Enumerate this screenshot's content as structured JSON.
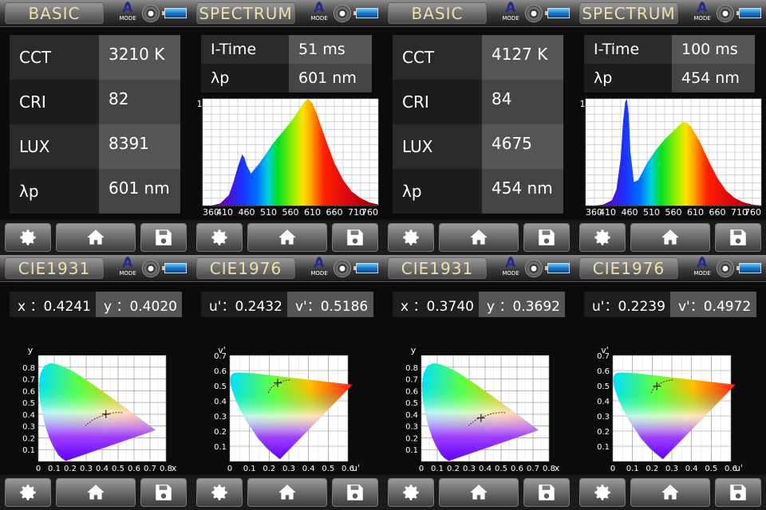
{
  "ui": {
    "mode_letter": "A",
    "mode_text": "MODE"
  },
  "basic1": {
    "title": "BASIC",
    "rows": [
      {
        "label": "CCT",
        "value": "3210 K"
      },
      {
        "label": "CRI",
        "value": "82"
      },
      {
        "label": "LUX",
        "value": "8391"
      },
      {
        "label": "λp",
        "value": "601 nm"
      }
    ]
  },
  "basic2": {
    "title": "BASIC",
    "rows": [
      {
        "label": "CCT",
        "value": "4127 K"
      },
      {
        "label": "CRI",
        "value": "84"
      },
      {
        "label": "LUX",
        "value": "4675"
      },
      {
        "label": "λp",
        "value": "454 nm"
      }
    ]
  },
  "spectrum1": {
    "title": "SPECTRUM",
    "itime_label": "I-Time",
    "itime_value": "51 ms",
    "lp_label": "λp",
    "lp_value": "601 nm",
    "y_max": "1"
  },
  "spectrum2": {
    "title": "SPECTRUM",
    "itime_label": "I-Time",
    "itime_value": "100 ms",
    "lp_label": "λp",
    "lp_value": "454 nm",
    "y_max": "1"
  },
  "cie1931_1": {
    "title": "CIE1931",
    "x_text": "x ：0.4241",
    "y_text": "y ：0.4020"
  },
  "cie1931_2": {
    "title": "CIE1931",
    "x_text": "x ：0.3740",
    "y_text": "y ：0.3692"
  },
  "cie1976_1": {
    "title": "CIE1976",
    "u_text": "u'：0.2432",
    "v_text": "v'：0.5186"
  },
  "cie1976_2": {
    "title": "CIE1976",
    "u_text": "u'：0.2239",
    "v_text": "v'：0.4972"
  },
  "chart_data": [
    {
      "type": "area",
      "title": "",
      "xlabel": "",
      "ylabel": "",
      "xticks": [
        360,
        410,
        460,
        510,
        560,
        610,
        660,
        710,
        760
      ],
      "xlim": [
        360,
        760
      ],
      "ylim": [
        0,
        1
      ],
      "x": [
        380,
        400,
        420,
        430,
        440,
        450,
        455,
        460,
        470,
        480,
        490,
        500,
        520,
        540,
        560,
        580,
        590,
        600,
        610,
        620,
        640,
        660,
        680,
        700,
        720,
        740,
        760
      ],
      "series": [
        {
          "values": [
            0,
            0.02,
            0.1,
            0.22,
            0.36,
            0.48,
            0.45,
            0.38,
            0.3,
            0.35,
            0.4,
            0.46,
            0.58,
            0.68,
            0.78,
            0.9,
            0.96,
            1.0,
            0.96,
            0.86,
            0.62,
            0.4,
            0.24,
            0.13,
            0.07,
            0.03,
            0.01
          ]
        }
      ]
    },
    {
      "type": "area",
      "title": "",
      "xlabel": "",
      "ylabel": "",
      "xticks": [
        360,
        410,
        460,
        510,
        560,
        610,
        660,
        710,
        760
      ],
      "xlim": [
        360,
        760
      ],
      "ylim": [
        0,
        1
      ],
      "x": [
        380,
        400,
        420,
        430,
        440,
        445,
        450,
        454,
        458,
        462,
        470,
        480,
        490,
        500,
        520,
        540,
        560,
        580,
        590,
        600,
        620,
        640,
        660,
        680,
        700,
        720,
        740,
        760
      ],
      "series": [
        {
          "values": [
            0,
            0.01,
            0.05,
            0.15,
            0.45,
            0.78,
            0.97,
            1.0,
            0.86,
            0.5,
            0.22,
            0.24,
            0.32,
            0.4,
            0.52,
            0.62,
            0.7,
            0.78,
            0.78,
            0.74,
            0.6,
            0.42,
            0.26,
            0.14,
            0.07,
            0.03,
            0.01,
            0
          ]
        }
      ]
    },
    {
      "type": "scatter",
      "title": "",
      "xlabel": "x",
      "ylabel": "y",
      "xlim": [
        0,
        0.8
      ],
      "ylim": [
        0,
        0.9
      ],
      "points": [
        {
          "x": 0.4241,
          "y": 0.402
        }
      ]
    },
    {
      "type": "scatter",
      "title": "",
      "xlabel": "u'",
      "ylabel": "v'",
      "xlim": [
        0,
        0.7
      ],
      "ylim": [
        0,
        0.7
      ],
      "points": [
        {
          "u": 0.2432,
          "v": 0.5186
        }
      ]
    },
    {
      "type": "scatter",
      "title": "",
      "xlabel": "x",
      "ylabel": "y",
      "xlim": [
        0,
        0.8
      ],
      "ylim": [
        0,
        0.9
      ],
      "points": [
        {
          "x": 0.374,
          "y": 0.3692
        }
      ]
    },
    {
      "type": "scatter",
      "title": "",
      "xlabel": "u'",
      "ylabel": "v'",
      "xlim": [
        0,
        0.7
      ],
      "ylim": [
        0,
        0.7
      ],
      "points": [
        {
          "u": 0.2239,
          "v": 0.4972
        }
      ]
    }
  ]
}
